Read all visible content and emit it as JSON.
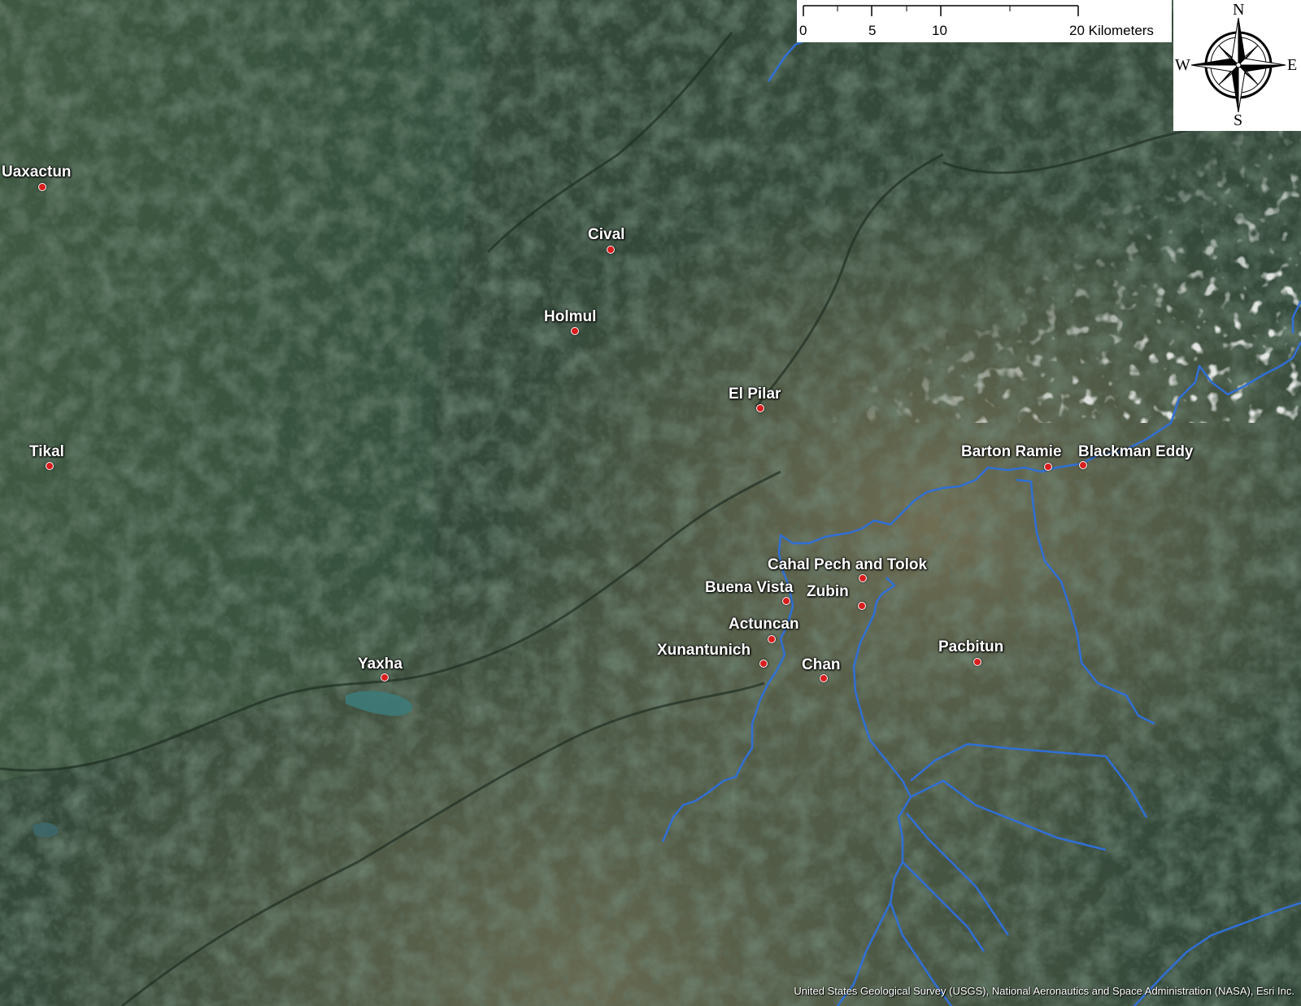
{
  "map": {
    "colors": {
      "forest_dark": "#2f4634",
      "forest_mid": "#3f5b45",
      "terrain_tan": "#7a7256",
      "lake": "#3d7a78",
      "river": "#2f6fd6",
      "marker": "#d81e1e",
      "label": "#ffffff"
    },
    "sites": [
      {
        "name": "Uaxactun"
      },
      {
        "name": "Tikal"
      },
      {
        "name": "Cival"
      },
      {
        "name": "Holmul"
      },
      {
        "name": "El Pilar"
      },
      {
        "name": "Yaxha"
      },
      {
        "name": "Barton Ramie"
      },
      {
        "name": "Blackman Eddy"
      },
      {
        "name": "Cahal Pech and Tolok"
      },
      {
        "name": "Buena Vista"
      },
      {
        "name": "Zubin"
      },
      {
        "name": "Actuncan"
      },
      {
        "name": "Xunantunich"
      },
      {
        "name": "Chan"
      },
      {
        "name": "Pacbitun"
      }
    ],
    "scale_bar": {
      "ticks": [
        "0",
        "5",
        "10",
        "20 Kilometers"
      ]
    },
    "compass": {
      "north": "N",
      "south": "S",
      "east": "E",
      "west": "W"
    },
    "attribution": "United States Geological Survey (USGS), National Aeronautics and Space Administration (NASA), Esri Inc."
  }
}
